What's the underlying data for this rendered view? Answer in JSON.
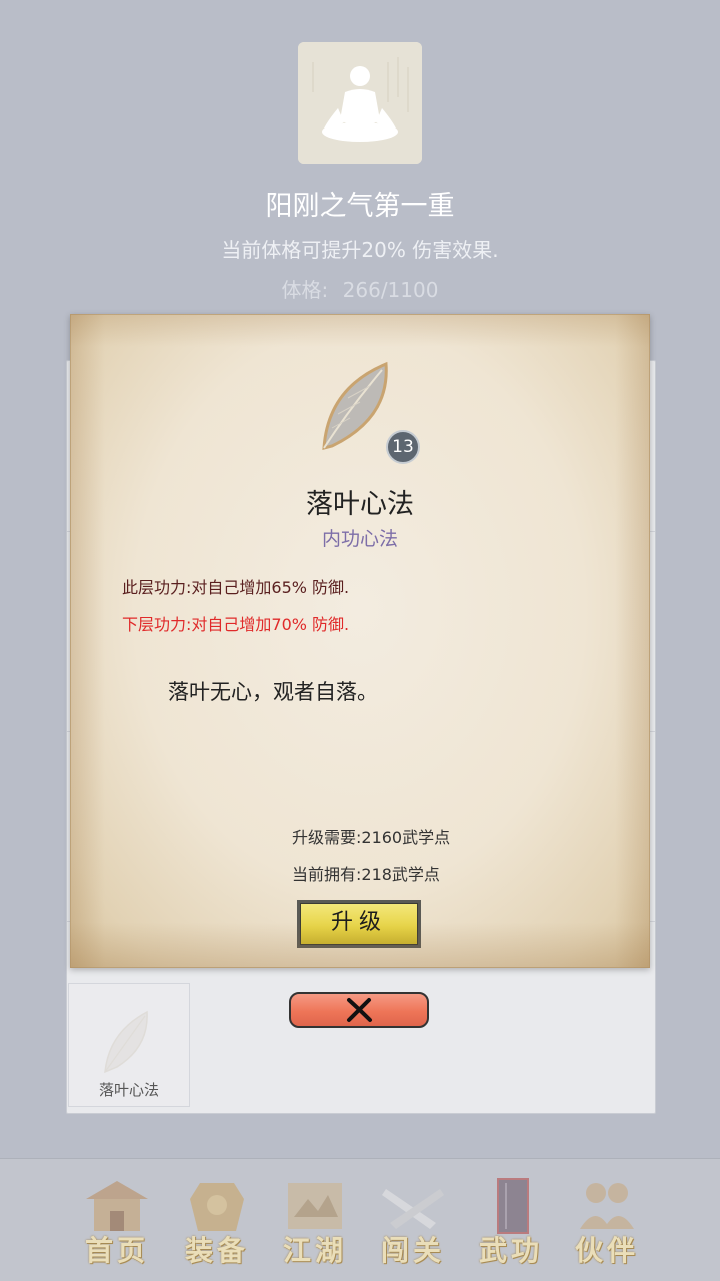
{
  "header": {
    "realm_title": "阳刚之气第一重",
    "realm_desc": "当前体格可提升20% 伤害效果.",
    "stat_label": "体格:",
    "stat_value": "266/1100"
  },
  "skill_popup": {
    "level": "13",
    "name": "落叶心法",
    "type": "内功心法",
    "current_effect": "此层功力:对自己增加65% 防御.",
    "next_effect": "下层功力:对自己增加70% 防御.",
    "flavor_text": "落叶无心，观者自落。",
    "upgrade_cost": "升级需要:2160武学点",
    "current_points": "当前拥有:218武学点",
    "upgrade_label": "升级",
    "icon": "leaf-icon"
  },
  "skill_list": {
    "items": [
      {
        "label": "落叶心法",
        "icon": "leaf-icon"
      }
    ]
  },
  "close_icon": "close-icon",
  "bottom_nav": {
    "items": [
      {
        "label": "首页",
        "icon": "house-icon"
      },
      {
        "label": "装备",
        "icon": "armor-icon"
      },
      {
        "label": "江湖",
        "icon": "map-icon"
      },
      {
        "label": "闯关",
        "icon": "swords-icon"
      },
      {
        "label": "武功",
        "icon": "book-icon"
      },
      {
        "label": "伙伴",
        "icon": "people-icon"
      }
    ]
  },
  "colors": {
    "background": "#b9bdc8",
    "next_effect": "#e02a2a",
    "current_effect": "#5a1f1f",
    "skill_type": "#7d6ea8",
    "upgrade_button": "#e6d345",
    "close_button": "#ee7558"
  }
}
